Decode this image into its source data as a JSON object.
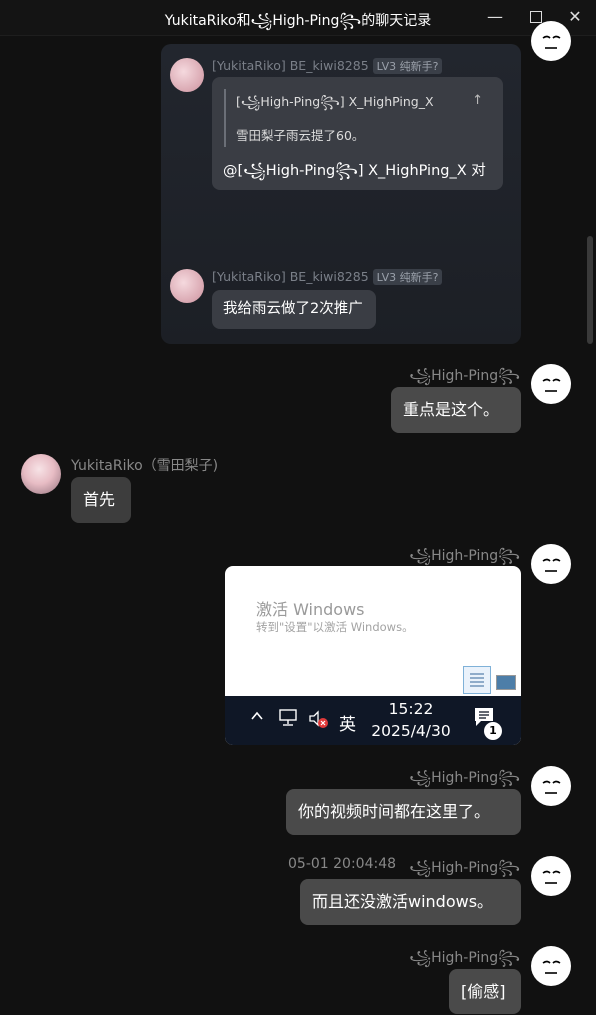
{
  "window": {
    "title": "YukitaRiko和꧁High-Ping꧂的聊天记录",
    "minimize": "—",
    "close": "✕"
  },
  "forward": {
    "msg1": {
      "sender": "[YukitaRiko] BE_kiwi8285",
      "badge": "LV3 纯新手?",
      "quote_line1": "[꧁High-Ping꧂] X_HighPing_X",
      "quote_line2": "雪田梨子雨云提了60。",
      "quote_icon": "↑",
      "text": "@[꧁High-Ping꧂] X_HighPing_X 对"
    },
    "msg2": {
      "sender": "[YukitaRiko] BE_kiwi8285",
      "badge": "LV3 纯新手?",
      "text": "我给雨云做了2次推广"
    }
  },
  "messages": [
    {
      "sender": "꧁High-Ping꧂",
      "text": "重点是这个。"
    },
    {
      "sender": "YukitaRiko（雪田梨子)",
      "text": "首先"
    },
    {
      "sender": "꧁High-Ping꧂",
      "image": true
    },
    {
      "sender": "꧁High-Ping꧂",
      "text": "你的视频时间都在这里了。"
    },
    {
      "timestamp": "05-01 20:04:48",
      "sender": "꧁High-Ping꧂",
      "text": "而且还没激活windows。"
    },
    {
      "sender": "꧁High-Ping꧂",
      "text": "[偷感]"
    }
  ],
  "screenshot": {
    "activate_title": "激活 Windows",
    "activate_sub": "转到\"设置\"以激活 Windows。",
    "time": "15:22",
    "date": "2025/4/30",
    "ime": "英",
    "notif_count": "1",
    "tray_up": "^"
  }
}
